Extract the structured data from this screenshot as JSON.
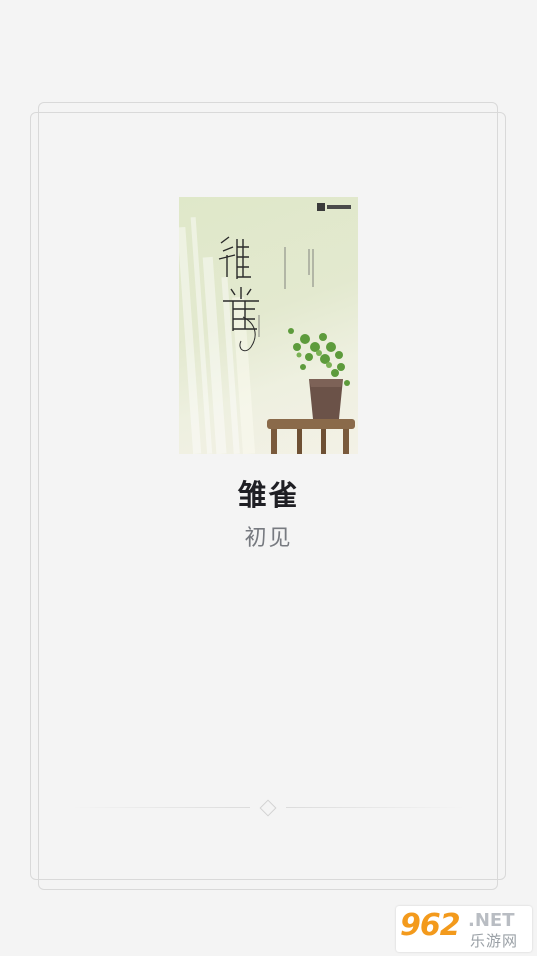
{
  "book": {
    "title": "雏雀",
    "author": "初见",
    "cover": {
      "title_text": "雏雀",
      "author_line": "初见 作品",
      "publisher_logo": "publisher-logo"
    }
  },
  "watermark": {
    "number": "962",
    "suffix": ".NET",
    "site_name": "乐游网"
  }
}
